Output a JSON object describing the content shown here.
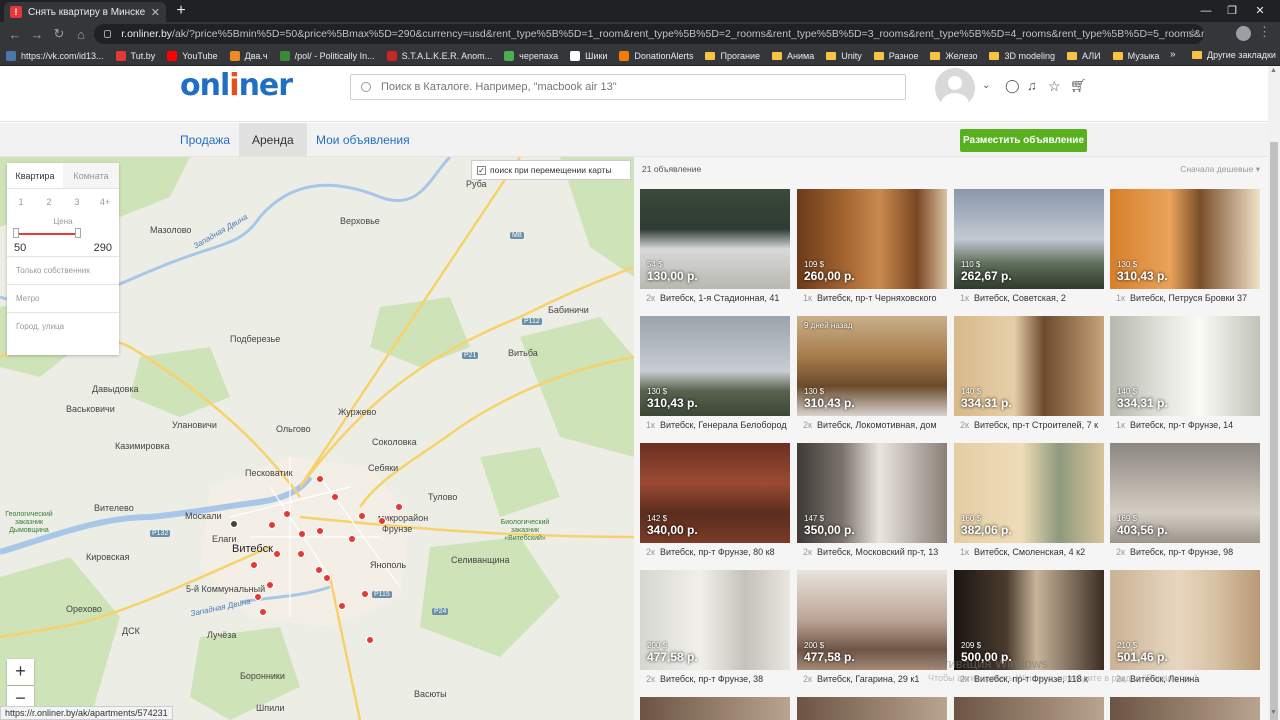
{
  "browser": {
    "tab_title": "Снять квартиру в Минске на дл",
    "tab_favicon_letter": "!",
    "url_domain": "r.onliner.by",
    "url_path": "/ak/?price%5Bmin%5D=50&price%5Bmax%5D=290&currency=usd&rent_type%5B%5D=1_room&rent_type%5B%5D=2_rooms&rent_type%5B%5D=3_rooms&rent_type%5B%5D=4_rooms&rent_type%5B%5D=5_rooms&rent_type%5B%5D=6_rooms#b...",
    "bookmarks": [
      {
        "label": "https://vk.com/id13...",
        "color": "#4a76a8"
      },
      {
        "label": "Tut.by",
        "color": "#e53935"
      },
      {
        "label": "YouTube",
        "color": "#ff0000"
      },
      {
        "label": "Два.ч",
        "color": "#f08a24"
      },
      {
        "label": "/pol/ - Politically In...",
        "color": "#3a8a3a"
      },
      {
        "label": "S.T.A.L.K.E.R. Anom...",
        "color": "#c62828"
      },
      {
        "label": "черепаха",
        "color": "#4caf50"
      },
      {
        "label": "Шики",
        "color": "#ffffff"
      },
      {
        "label": "DonationAlerts",
        "color": "#f57c00"
      }
    ],
    "bookmark_folders": [
      "Прогание",
      "Анима",
      "Unity",
      "Разное",
      "Железо",
      "3D modeling",
      "АЛИ",
      "Музыка"
    ],
    "bookmarks_more": "»",
    "other_bookmarks": "Другие закладки"
  },
  "header": {
    "logo_main": "onl",
    "logo_accent": "i",
    "logo_rest": "ner",
    "search_placeholder": "Поиск в Каталоге. Например, \"macbook air 13\""
  },
  "subnav": {
    "items": [
      "Продажа",
      "Аренда",
      "Мои объявления"
    ],
    "active_index": 1,
    "post_button": "Разместить объявление"
  },
  "filter": {
    "tabs": [
      "Квартира",
      "Комната"
    ],
    "rooms": [
      "1",
      "2",
      "3",
      "4+"
    ],
    "price_label": "Цена",
    "price_min": "50",
    "price_max": "290",
    "only_owners": "Только собственник",
    "metro": "Метро",
    "city_street": "Город, улица"
  },
  "map": {
    "toggle_label": "поиск при перемещении карты",
    "toggle_checked": true,
    "zoom_in": "+",
    "zoom_out": "−",
    "labels": {
      "ruba": "Руба",
      "verkhovye": "Верховье",
      "mazolovo": "Мазолово",
      "babinichi": "Бабиничи",
      "podberezye": "Подберезье",
      "vitba": "Витьба",
      "davydovka": "Давыдовка",
      "vaskovichi": "Васьковичи",
      "zhurzhevo": "Журжево",
      "ulanovichi": "Улановичи",
      "olgovo": "Ольгово",
      "kazimirovka": "Казимировка",
      "sokolovka": "Соколовка",
      "sebyaki": "Себяки",
      "peskovatik": "Песковатик",
      "tulovo": "Тулово",
      "vitelevo": "Вителево",
      "moskali": "Москали",
      "elagi": "Елаги",
      "vitebsk": "Витебск",
      "mikrorayon": "микрорайон",
      "frunze": "Фрунзе",
      "kirovskaya": "Кировская",
      "yanopol": "Янополь",
      "selivanshchina": "Селиванщина",
      "kommunalny": "5-й Коммунальный",
      "orekhovo": "Орехово",
      "dsk": "ДСК",
      "lucheza": "Лучёза",
      "boronniki": "Боронники",
      "vasyuty": "Васюты",
      "shpili": "Шпили",
      "zapadnaya_dvina": "Западная Двина",
      "bio_reserve": "Биологический заказник «Витебский»",
      "geo_reserve": "Геологический заказник Дымовщина"
    },
    "roads": [
      "M8",
      "P112",
      "P21",
      "P132",
      "P24",
      "P115"
    ]
  },
  "listings": {
    "count_text": "21 объявление",
    "sort_text": "Сначала дешевые",
    "items": [
      {
        "usd": "54 $",
        "byn": "130,00 р.",
        "rooms": "2к",
        "address": "Витебск, 1-я Стадионная, 41",
        "scene": "house",
        "badge": ""
      },
      {
        "usd": "109 $",
        "byn": "260,00 р.",
        "rooms": "1к",
        "address": "Витебск, пр-т Черняховского",
        "scene": "wood",
        "badge": ""
      },
      {
        "usd": "110 $",
        "byn": "262,67 р.",
        "rooms": "1к",
        "address": "Витебск, Советская, 2",
        "scene": "sky",
        "badge": ""
      },
      {
        "usd": "130 $",
        "byn": "310,43 р.",
        "rooms": "1к",
        "address": "Витебск, Петруся Бровки 37",
        "scene": "orange",
        "badge": ""
      },
      {
        "usd": "130 $",
        "byn": "310,43 р.",
        "rooms": "1к",
        "address": "Витебск, Генерала Белобород",
        "scene": "sky2",
        "badge": ""
      },
      {
        "usd": "130 $",
        "byn": "310,43 р.",
        "rooms": "2к",
        "address": "Витебск, Локомотивная, дом",
        "scene": "kitchen",
        "badge": "9 дней назад"
      },
      {
        "usd": "140 $",
        "byn": "334,31 р.",
        "rooms": "2к",
        "address": "Витебск, пр-т Строителей, 7 к",
        "scene": "room",
        "badge": ""
      },
      {
        "usd": "140 $",
        "byn": "334,31 р.",
        "rooms": "1к",
        "address": "Витебск, пр-т Фрунзе, 14",
        "scene": "bright",
        "badge": ""
      },
      {
        "usd": "142 $",
        "byn": "340,00 р.",
        "rooms": "2к",
        "address": "Витебск, пр-т Фрунзе, 80 к8",
        "scene": "red",
        "badge": ""
      },
      {
        "usd": "147 $",
        "byn": "350,00 р.",
        "rooms": "2к",
        "address": "Витебск, Московский пр-т, 13",
        "scene": "curtain",
        "badge": ""
      },
      {
        "usd": "160 $",
        "byn": "382,06 р.",
        "rooms": "1к",
        "address": "Витебск, Смоленская, 4 к2",
        "scene": "room2",
        "badge": ""
      },
      {
        "usd": "169 $",
        "byn": "403,56 р.",
        "rooms": "2к",
        "address": "Витебск, пр-т Фрунзе, 98",
        "scene": "grey",
        "badge": ""
      },
      {
        "usd": "200 $",
        "byn": "477,58 р.",
        "rooms": "2к",
        "address": "Витебск, пр-т Фрунзе, 38",
        "scene": "white",
        "badge": ""
      },
      {
        "usd": "200 $",
        "byn": "477,58 р.",
        "rooms": "2к",
        "address": "Витебск, Гагарина, 29 к1",
        "scene": "ceiling",
        "badge": ""
      },
      {
        "usd": "209 $",
        "byn": "500,00 р.",
        "rooms": "2к",
        "address": "Витебск, пр-т Фрунзе, 118 к",
        "scene": "dark",
        "badge": ""
      },
      {
        "usd": "210 $",
        "byn": "501,46 р.",
        "rooms": "2к",
        "address": "Витебск, Ленина",
        "scene": "beige",
        "badge": ""
      }
    ]
  },
  "status_url": "https://r.onliner.by/ak/apartments/574231",
  "watermark": {
    "line1": "Активация Windows",
    "line2": "Чтобы активировать Windows, перейдите в раздел \"Параметры\"."
  }
}
